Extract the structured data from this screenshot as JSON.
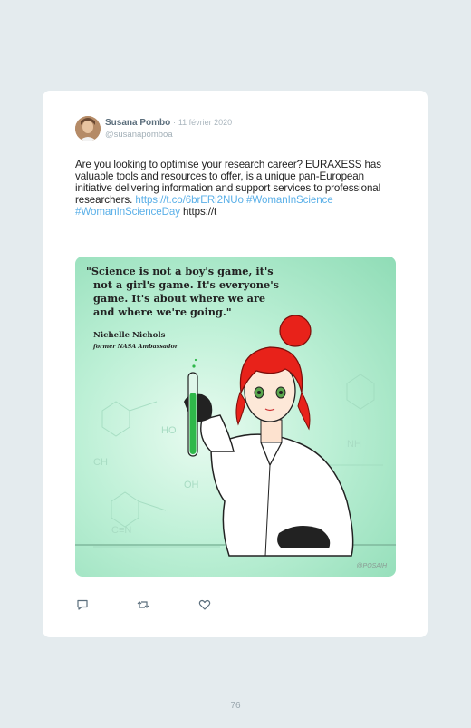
{
  "tweet": {
    "author_name": "Susana Pombo",
    "separator": "·",
    "date": "11 février 2020",
    "handle": "@susanapomboa",
    "text_body": "Are you looking to optimise your research career? EURAXESS has valuable tools and resources to offer, is a unique pan-European initiative delivering information and support services to professional researchers.",
    "link_url": "https://t.co/6brERi2NUo",
    "hashtag_1": "#WomanInScience",
    "hashtag_2": "#WomanInScienceDay",
    "trailing_text": "https://t"
  },
  "media": {
    "quote_line_1": "\"Science is not a boy's game, it's",
    "quote_line_2": "not a girl's game. It's everyone's",
    "quote_line_3": "game. It's about where we are",
    "quote_line_4": "and where we're going.\"",
    "author": "Nichelle Nichols",
    "author_title": "former NASA Ambassador",
    "credit": "@POSAIH"
  },
  "actions": {
    "reply_icon": "reply-icon",
    "retweet_icon": "retweet-icon",
    "like_icon": "heart-icon"
  },
  "page_number": "76",
  "colors": {
    "background": "#e4ebee",
    "link": "#5bb0e8",
    "hair": "#e8221a",
    "tube_liquid": "#2fb84a"
  }
}
